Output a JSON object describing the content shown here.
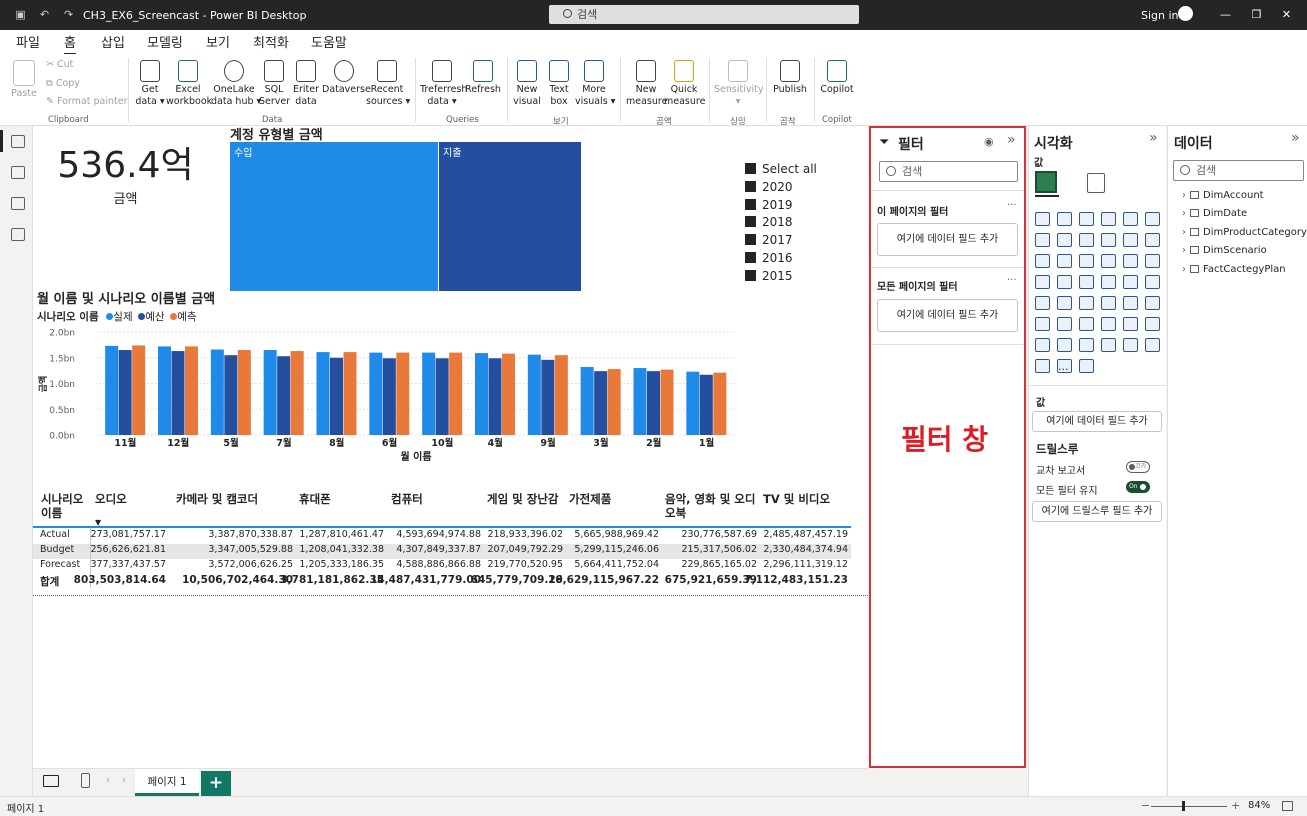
{
  "titlebar": {
    "doc_title": "CH3_EX6_Screencast - Power BI Desktop",
    "search_placeholder": "검색",
    "sign_in": "Sign in"
  },
  "menu": [
    "파일",
    "홈",
    "삽입",
    "모델링",
    "보기",
    "최적화",
    "도움말"
  ],
  "ribbon": {
    "clipboard": {
      "paste": "Paste",
      "cut": "Cut",
      "copy": "Copy",
      "format_painter": "Format painter",
      "group": "Clipboard"
    },
    "data": [
      {
        "l1": "Get",
        "l2": "data ▾"
      },
      {
        "l1": "Excel",
        "l2": "workbook"
      },
      {
        "l1": "OneLake",
        "l2": "data hub ▾"
      },
      {
        "l1": "SQL",
        "l2": "Server"
      },
      {
        "l1": "Eriter",
        "l2": "data"
      },
      {
        "l1": "Dataverse",
        "l2": ""
      },
      {
        "l1": "Recent",
        "l2": "sources ▾"
      }
    ],
    "data_group": "Data",
    "queries": [
      {
        "l1": "Treferresh",
        "l2": "data ▾"
      },
      {
        "l1": "Refresh",
        "l2": ""
      }
    ],
    "queries_group": "Queries",
    "insert": [
      {
        "l1": "New",
        "l2": "visual"
      },
      {
        "l1": "Text",
        "l2": "box"
      },
      {
        "l1": "More",
        "l2": "visuals ▾"
      }
    ],
    "insert_group": "보기",
    "calc": [
      {
        "l1": "New",
        "l2": "measure"
      },
      {
        "l1": "Quick",
        "l2": "measure"
      }
    ],
    "calc_group": "곰액",
    "sens": {
      "l1": "Sensitivity",
      "l2": "▾"
    },
    "sens_group": "싱밍",
    "publish": {
      "l1": "Publish",
      "l2": ""
    },
    "publish_group": "곰착",
    "copilot": {
      "l1": "Copilot",
      "l2": ""
    },
    "copilot_group": "Copilot"
  },
  "card": {
    "value": "536.4억",
    "label": "금액"
  },
  "treemap": {
    "title": "계정 유형별 금액",
    "items": [
      {
        "label": "수입",
        "value": 59.6,
        "color": "#1f8ae8"
      },
      {
        "label": "지출",
        "value": 40.4,
        "color": "#234f9e"
      }
    ]
  },
  "slicer": {
    "items": [
      "Select all",
      "2020",
      "2019",
      "2018",
      "2017",
      "2016",
      "2015"
    ]
  },
  "chart_data": {
    "type": "bar",
    "title": "월 이름 및 시나리오 이름별 금액",
    "legend_title": "시나리오 이름",
    "xlabel": "월 이름",
    "ylabel": "금액",
    "ylim": [
      0,
      2.0
    ],
    "yticks": [
      "0.0bn",
      "0.5bn",
      "1.0bn",
      "1.5bn",
      "2.0bn"
    ],
    "categories": [
      "11월",
      "12월",
      "5월",
      "7월",
      "8월",
      "6월",
      "10월",
      "4월",
      "9월",
      "3월",
      "2월",
      "1월"
    ],
    "series": [
      {
        "name": "실제",
        "color": "#1f8ae8",
        "values": [
          1.73,
          1.72,
          1.66,
          1.65,
          1.61,
          1.6,
          1.6,
          1.59,
          1.56,
          1.32,
          1.3,
          1.23
        ]
      },
      {
        "name": "예산",
        "color": "#234f9e",
        "values": [
          1.65,
          1.63,
          1.55,
          1.53,
          1.5,
          1.49,
          1.49,
          1.49,
          1.46,
          1.24,
          1.24,
          1.17
        ]
      },
      {
        "name": "예측",
        "color": "#e8793a",
        "values": [
          1.74,
          1.72,
          1.65,
          1.63,
          1.61,
          1.6,
          1.6,
          1.58,
          1.55,
          1.28,
          1.27,
          1.21
        ]
      }
    ]
  },
  "matrix": {
    "headers": [
      "시나리오 이름",
      "오디오",
      "카메라 및 캠코더",
      "휴대폰",
      "컴퓨터",
      "게임 및 장난감",
      "가전제품",
      "음악, 영화 및 오디오북",
      "TV 및 비디오"
    ],
    "rows": [
      [
        "Actual",
        "273,081,757.17",
        "3,387,870,338.87",
        "1,287,810,461.47",
        "4,593,694,974.88",
        "218,933,396.02",
        "5,665,988,969.42",
        "230,776,587.69",
        "2,485,487,457.19"
      ],
      [
        "Budget",
        "256,626,621.81",
        "3,347,005,529.88",
        "1,208,041,332.38",
        "4,307,849,337.87",
        "207,049,792.29",
        "5,299,115,246.06",
        "215,317,506.02",
        "2,330,484,374.94"
      ],
      [
        "Forecast",
        "377,337,437.57",
        "3,572,006,626.25",
        "1,205,333,186.35",
        "4,588,886,866.88",
        "219,770,520.95",
        "5,664,411,752.04",
        "229,865,165.02",
        "2,296,111,319.12"
      ],
      [
        "합계",
        "803,503,814.64",
        "10,506,702,464.30",
        "3,781,181,862.35",
        "14,487,431,779.00",
        "645,779,709.29",
        "16,629,115,967.22",
        "675,921,659.39",
        "7,112,483,151.23"
      ]
    ]
  },
  "filters": {
    "title": "필터",
    "search": "검색",
    "page_filters": "이 페이지의 필터",
    "all_filters": "모든 페이지의 필터",
    "add_field": "여기에 데이터 필드 추가",
    "annotation": "필터 창"
  },
  "viz": {
    "title": "시각화",
    "values_heading": "값",
    "values_label": "값",
    "add_field": "여기에 데이터 필드 추가",
    "drillthrough": "드릴스루",
    "cross_report": "교차 보고서",
    "cross_report_state": "끄기",
    "keep_filters": "모든 필터 유지",
    "keep_filters_state": "On",
    "add_drill": "여기에 드릴스루 필드 추가",
    "more": "···"
  },
  "data_pane": {
    "title": "데이터",
    "search": "검색",
    "tables": [
      "DimAccount",
      "DimDate",
      "DimProductCategory",
      "DimScenario",
      "FactCactegyPlan"
    ]
  },
  "tabs": {
    "page": "페이지 1",
    "add": "+"
  },
  "status": {
    "page": "페이지 1",
    "zoom": "84%"
  }
}
